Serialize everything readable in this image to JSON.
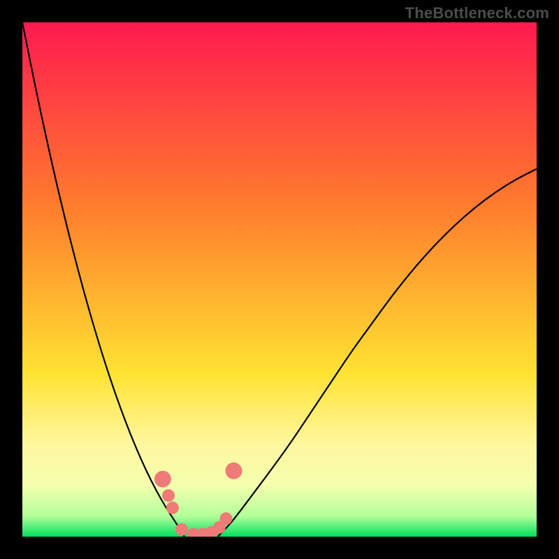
{
  "watermark": "TheBottleneck.com",
  "chart_data": {
    "type": "line",
    "title": "",
    "xlabel": "",
    "ylabel": "",
    "xlim": [
      0,
      100
    ],
    "ylim": [
      0,
      100
    ],
    "grid": false,
    "legend": false,
    "background_gradient": {
      "top": "#ff1a50",
      "mid1": "#ff7a2d",
      "mid2": "#ffe231",
      "band1": "#fff79f",
      "band2": "#f4ffae",
      "band3": "#b4ff9a",
      "bottom": "#00e05e"
    },
    "series": [
      {
        "name": "left-curve",
        "color": "#000000",
        "x": [
          0,
          2,
          4,
          6,
          8,
          10,
          12,
          14,
          16,
          18,
          20,
          22,
          24,
          26,
          28,
          30,
          31.5
        ],
        "y": [
          100,
          90,
          80.5,
          71.5,
          63,
          55,
          47.5,
          40.5,
          34,
          28,
          22.5,
          17.5,
          13,
          9,
          5.5,
          2.5,
          0
        ]
      },
      {
        "name": "right-curve",
        "color": "#000000",
        "x": [
          38,
          40,
          42,
          45,
          48,
          52,
          56,
          60,
          64,
          68,
          72,
          76,
          80,
          84,
          88,
          92,
          96,
          100
        ],
        "y": [
          0,
          2,
          4.5,
          8.5,
          12.5,
          18,
          24,
          30,
          36,
          41.5,
          47,
          52,
          56.5,
          60.5,
          64,
          67,
          69.5,
          71.5
        ]
      }
    ],
    "markers": {
      "name": "data-points",
      "color": "#ef7a78",
      "radius_large": 12,
      "radius_small": 9,
      "points": [
        {
          "x": 27.3,
          "y": 11.2,
          "r": "large"
        },
        {
          "x": 28.4,
          "y": 8.0,
          "r": "small"
        },
        {
          "x": 29.2,
          "y": 5.6,
          "r": "small"
        },
        {
          "x": 31.0,
          "y": 1.4,
          "r": "small"
        },
        {
          "x": 33.3,
          "y": 0.5,
          "r": "small"
        },
        {
          "x": 35.0,
          "y": 0.5,
          "r": "small"
        },
        {
          "x": 36.7,
          "y": 0.8,
          "r": "small"
        },
        {
          "x": 38.3,
          "y": 1.8,
          "r": "small"
        },
        {
          "x": 39.6,
          "y": 3.5,
          "r": "small"
        },
        {
          "x": 41.1,
          "y": 12.8,
          "r": "large"
        }
      ]
    }
  }
}
